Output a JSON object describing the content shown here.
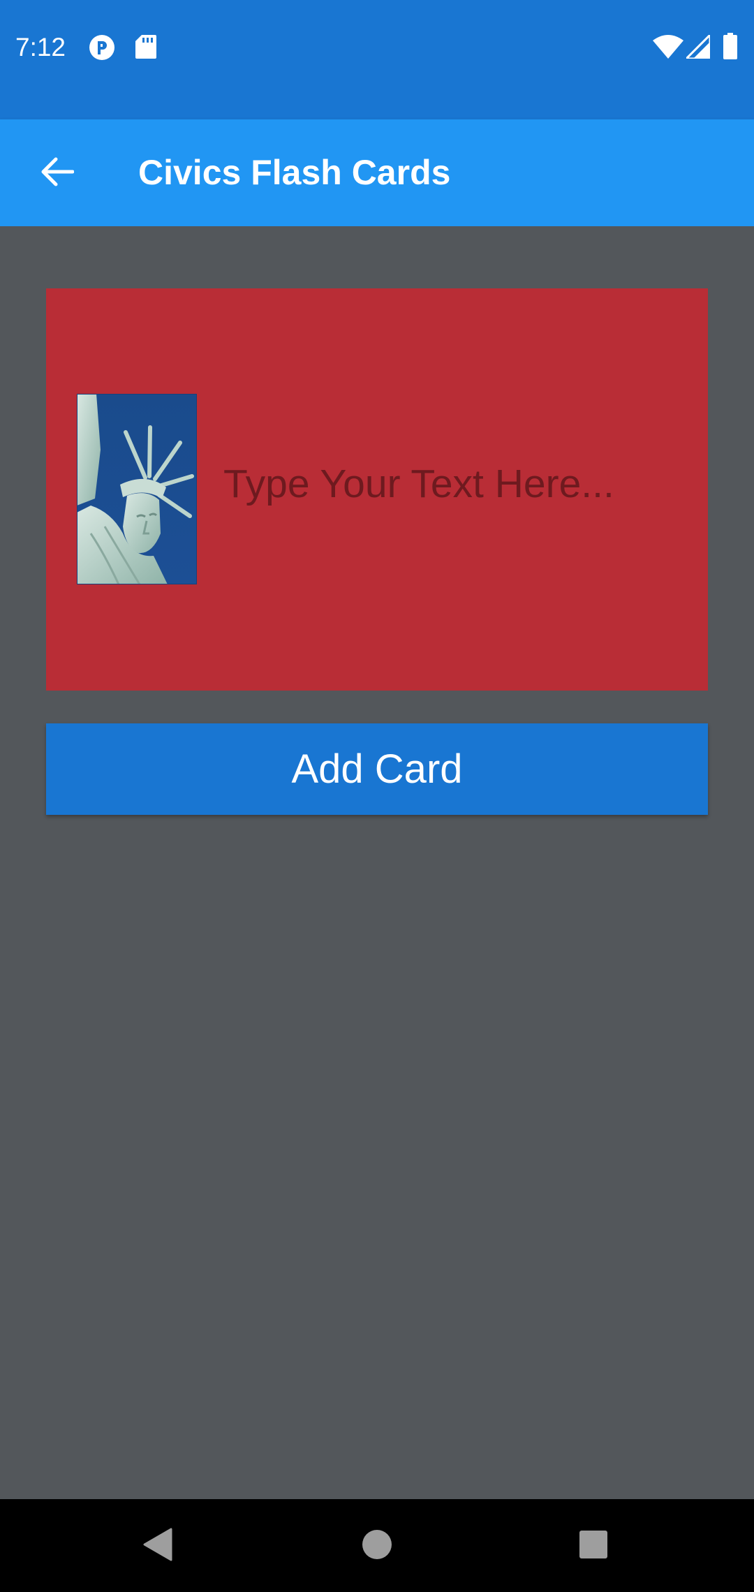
{
  "status_bar": {
    "time": "7:12",
    "left_icons": [
      "pocket-icon",
      "sd-card-icon"
    ],
    "right_icons": [
      "wifi-icon",
      "signal-icon",
      "battery-icon"
    ]
  },
  "app_bar": {
    "title": "Civics Flash Cards",
    "back_icon": "arrow-back-icon"
  },
  "card": {
    "background_color": "#b92d36",
    "image": "statue-of-liberty-image",
    "text_placeholder": "Type Your Text Here...",
    "text_value": ""
  },
  "add_card_button": {
    "label": "Add Card"
  },
  "colors": {
    "status_bar": "#1976d2",
    "app_bar": "#2196f3",
    "content_bg": "#53575b",
    "button": "#1976d2"
  },
  "nav_bar": {
    "buttons": [
      "back-triangle-icon",
      "home-circle-icon",
      "recents-square-icon"
    ]
  }
}
